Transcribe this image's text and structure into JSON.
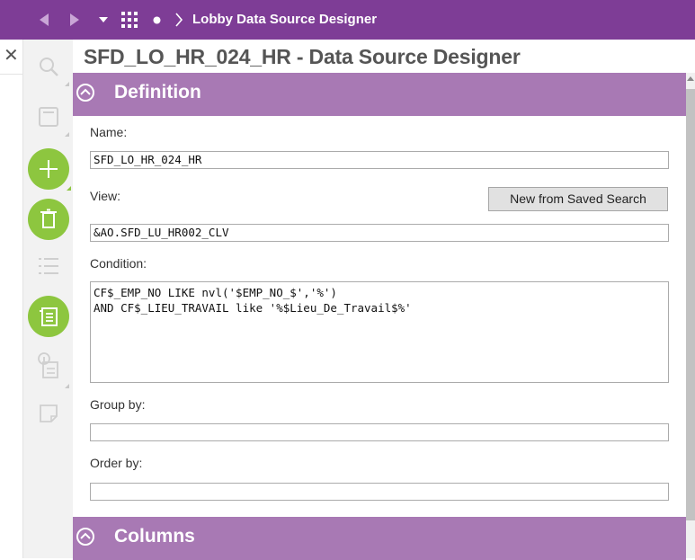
{
  "topbar": {
    "title": "Lobby Data Source Designer",
    "back_icon": "back-arrow-icon",
    "forward_icon": "forward-arrow-icon",
    "menu_icon": "dropdown-caret-icon",
    "apps_icon": "grid-icon",
    "dot_icon": "dot-icon",
    "breadcrumb_icon": "chevron-right-icon",
    "color": "#7e3d96"
  },
  "page": {
    "title": "SFD_LO_HR_024_HR - Data Source Designer"
  },
  "sections": {
    "definition": {
      "title": "Definition",
      "color": "#a879b4"
    },
    "columns": {
      "title": "Columns",
      "color": "#a879b4"
    }
  },
  "form": {
    "name_label": "Name:",
    "name_value": "SFD_LO_HR_024_HR",
    "view_label": "View:",
    "view_value": "&AO.SFD_LU_HR002_CLV",
    "new_from_saved_search": "New from Saved Search",
    "condition_label": "Condition:",
    "condition_line1": "CF$_EMP_NO LIKE nvl('$EMP_NO_$','%')",
    "condition_line2": "AND CF$_LIEU_TRAVAIL like '%$Lieu_De_Travail$%'",
    "group_by_label": "Group by:",
    "group_by_value": "",
    "order_by_label": "Order by:",
    "order_by_value": ""
  },
  "sidebar": {
    "accent": "#8dc63f",
    "icons": [
      "search-icon",
      "save-icon",
      "add-icon",
      "delete-icon",
      "list-icon",
      "details-icon",
      "info-document-icon",
      "note-icon"
    ]
  }
}
